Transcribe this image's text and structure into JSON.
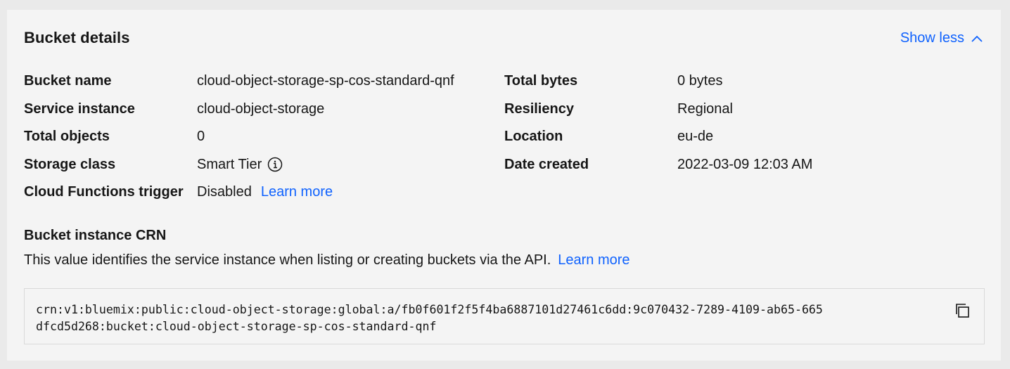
{
  "card": {
    "title": "Bucket details",
    "toggle_label": "Show less",
    "toggle_icon": "chevron-up-icon"
  },
  "details": {
    "bucket_name": {
      "label": "Bucket name",
      "value": "cloud-object-storage-sp-cos-standard-qnf"
    },
    "service_instance": {
      "label": "Service instance",
      "value": "cloud-object-storage"
    },
    "total_objects": {
      "label": "Total objects",
      "value": "0"
    },
    "storage_class": {
      "label": "Storage class",
      "value": "Smart Tier",
      "icon": "info-icon"
    },
    "cloud_functions_trigger": {
      "label": "Cloud Functions trigger",
      "value": "Disabled",
      "link": "Learn more"
    },
    "total_bytes": {
      "label": "Total bytes",
      "value": "0 bytes"
    },
    "resiliency": {
      "label": "Resiliency",
      "value": "Regional"
    },
    "location": {
      "label": "Location",
      "value": "eu-de"
    },
    "date_created": {
      "label": "Date created",
      "value": "2022-03-09 12:03 AM"
    }
  },
  "crn_section": {
    "heading": "Bucket instance CRN",
    "description": "This value identifies the service instance when listing or creating buckets via the API.",
    "link": "Learn more",
    "crn_line1": "crn:v1:bluemix:public:cloud-object-storage:global:a/fb0f601f2f5f4ba6887101d27461c6dd:9c070432-7289-4109-ab65-665",
    "crn_line2": "dfcd5d268:bucket:cloud-object-storage-sp-cos-standard-qnf",
    "copy_icon": "copy-icon"
  },
  "colors": {
    "link": "#0f62fe",
    "text": "#161616",
    "card_background": "#f4f4f4",
    "page_background": "#eaeaea"
  }
}
